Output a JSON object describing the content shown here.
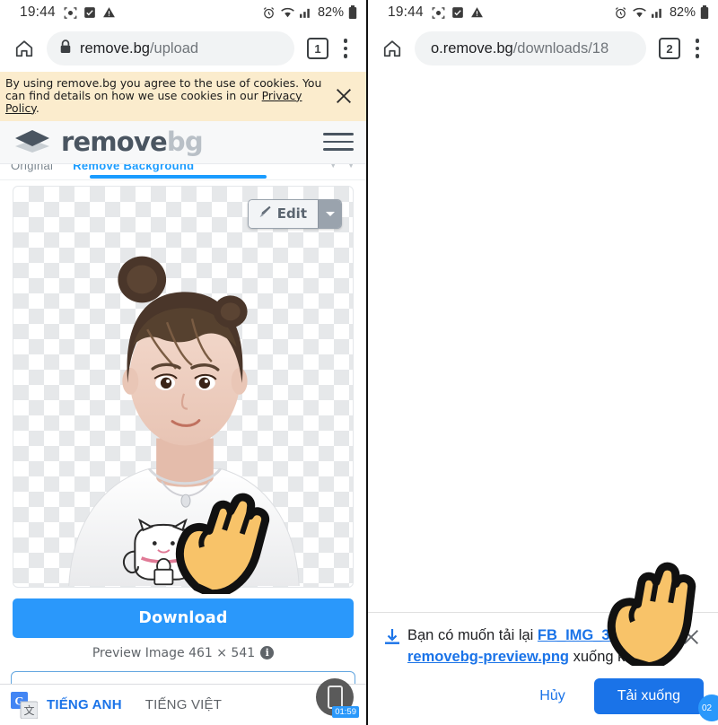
{
  "left": {
    "status": {
      "time": "19:44",
      "icons_left": [
        "camera-icon",
        "checkbox-icon",
        "warning-icon"
      ],
      "icons_right": [
        "alarm-icon",
        "wifi-icon",
        "signal-icon"
      ],
      "battery": "82%"
    },
    "browser": {
      "home": "home-icon",
      "lock": "lock-icon",
      "url_main": "remove.bg",
      "url_path": "/upload",
      "tab_count": "1",
      "menu": "kebab-menu-icon"
    },
    "cookie": {
      "text_before": "By using remove.bg you agree to the use of cookies. You can find details on how we use cookies in our ",
      "link": "Privacy Policy",
      "text_after": ".",
      "close": "close-icon"
    },
    "site": {
      "brand_1": "remove",
      "brand_2": "bg",
      "menu": "hamburger-icon"
    },
    "tabs": [
      {
        "label": "Original",
        "active": false
      },
      {
        "label": "Remove Background",
        "active": true
      }
    ],
    "preview": {
      "edit_label": "Edit",
      "edit_icon": "brush-icon",
      "caret_icon": "chevron-down-icon",
      "image_alt": "portrait-with-background-removed"
    },
    "download": {
      "button_label": "Download",
      "caption": "Preview Image 461 × 541",
      "info_icon": "info-icon"
    },
    "translate": {
      "icon": "google-translate-icon",
      "lang_selected": "TIẾNG ANH",
      "lang_other": "TIẾNG VIỆT",
      "menu": "kebab-menu-icon"
    },
    "recorder": {
      "icon": "phone-recorder-icon",
      "timer": "01:59"
    }
  },
  "right": {
    "status": {
      "time": "19:44",
      "battery": "82%"
    },
    "browser": {
      "home": "home-icon",
      "url_main": "o.remove.bg",
      "url_path": "/downloads/18",
      "tab_count": "2",
      "menu": "kebab-menu-icon"
    },
    "prompt": {
      "icon": "download-icon",
      "text_before": "Bạn có muốn tải lại ",
      "link": "FB_IMG_35296501-removebg-preview.png",
      "text_after": " xuống không?",
      "close": "close-icon",
      "cancel_label": "Hủy",
      "confirm_label": "Tải xuống"
    },
    "badge": "02"
  },
  "colors": {
    "accent_blue": "#2a98fb",
    "chrome_blue": "#1a73e8",
    "cookie_bg": "#fbeccd",
    "brand_dark": "#4a5561",
    "brand_light": "#b9c0c7",
    "hand_fill": "#f8c369"
  }
}
